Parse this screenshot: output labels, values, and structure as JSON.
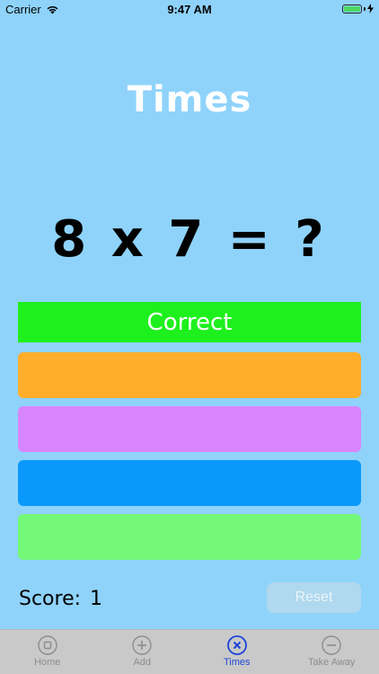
{
  "status_bar": {
    "carrier": "Carrier",
    "time": "9:47 AM"
  },
  "title": "Times",
  "question": "8 x 7 = ?",
  "answers": {
    "feedback": "Correct",
    "option_1": "",
    "option_2": "",
    "option_3": "",
    "option_4": ""
  },
  "score": {
    "label": "Score:",
    "value": "1"
  },
  "reset_label": "Reset",
  "tabs": [
    {
      "label": "Home",
      "icon": "home-square-icon",
      "active": false
    },
    {
      "label": "Add",
      "icon": "plus-circle-icon",
      "active": false
    },
    {
      "label": "Times",
      "icon": "times-circle-icon",
      "active": true
    },
    {
      "label": "Take Away",
      "icon": "minus-circle-icon",
      "active": false
    }
  ],
  "colors": {
    "background": "#8fd3fb",
    "correct": "#1ef01d",
    "orange": "#ffad2a",
    "purple": "#d884fb",
    "blue": "#0a99fa",
    "light_green": "#74f878",
    "tab_active": "#1f45d6"
  }
}
